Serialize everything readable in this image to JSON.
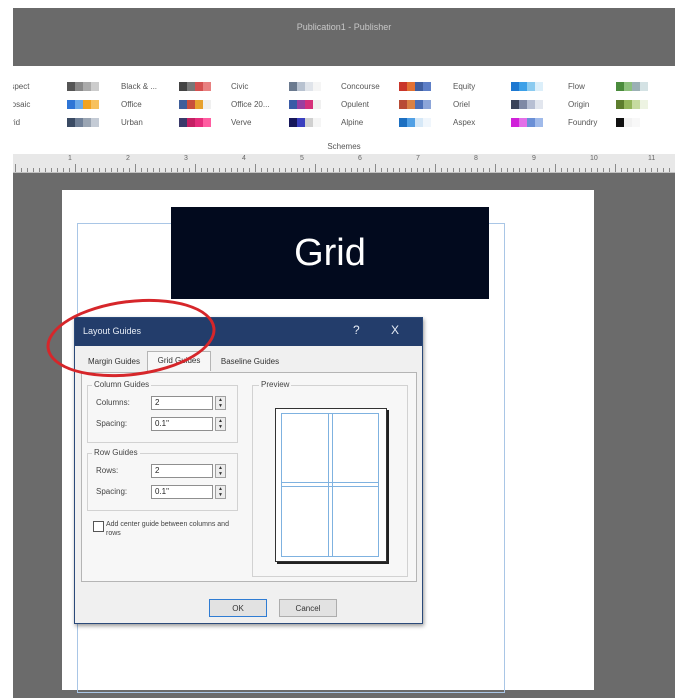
{
  "window": {
    "title": "Publication1 - Publisher"
  },
  "ribbon": {
    "group_label": "Schemes",
    "schemes": [
      {
        "name": "Aspect",
        "colors": [
          "#555555",
          "#888888",
          "#aaaaaa",
          "#cccccc"
        ]
      },
      {
        "name": "Mosaic",
        "colors": [
          "#2e75d6",
          "#6aa8e8",
          "#f2a321",
          "#f7c15d"
        ]
      },
      {
        "name": "Grid",
        "colors": [
          "#3a4a63",
          "#6f7f96",
          "#9aa5b3",
          "#c4cbd5"
        ]
      },
      {
        "name": "Black & ...",
        "colors": [
          "#444444",
          "#777777",
          "#d45050",
          "#e88080"
        ]
      },
      {
        "name": "Office",
        "colors": [
          "#3f5e9a",
          "#c94e3c",
          "#e7a12f",
          "#f0f0f0"
        ]
      },
      {
        "name": "Urban",
        "colors": [
          "#3a3a6a",
          "#c41f63",
          "#e52d7c",
          "#ff5da1"
        ]
      },
      {
        "name": "Civic",
        "colors": [
          "#6b7a8f",
          "#b8c2d0",
          "#e0e4ea",
          "#f5f5f5"
        ]
      },
      {
        "name": "Office 20...",
        "colors": [
          "#3a5ba6",
          "#9a3fa0",
          "#d6317b",
          "#f0f0f0"
        ]
      },
      {
        "name": "Verve",
        "colors": [
          "#16175a",
          "#3a3fbf",
          "#d0d0d0",
          "#f5f5f5"
        ]
      },
      {
        "name": "Concourse",
        "colors": [
          "#c9362b",
          "#e27133",
          "#3f5ea0",
          "#5d7ec6"
        ]
      },
      {
        "name": "Opulent",
        "colors": [
          "#b84b35",
          "#d98145",
          "#4b6fb8",
          "#8ca5d9"
        ]
      },
      {
        "name": "Alpine",
        "colors": [
          "#1c6fc1",
          "#51a0e5",
          "#d6e8f7",
          "#f0f6fc"
        ]
      },
      {
        "name": "Equity",
        "colors": [
          "#1d78d1",
          "#3ca0e8",
          "#8bcbf0",
          "#dceffa"
        ]
      },
      {
        "name": "Oriel",
        "colors": [
          "#3a4258",
          "#7f89a5",
          "#b7bfd3",
          "#e2e6ee"
        ]
      },
      {
        "name": "Aspex",
        "colors": [
          "#d021d9",
          "#e36fe8",
          "#6a8fd6",
          "#a0baea"
        ]
      },
      {
        "name": "Flow",
        "colors": [
          "#4a8b3c",
          "#8cc07c",
          "#9bb0b5",
          "#d4e2e4"
        ]
      },
      {
        "name": "Origin",
        "colors": [
          "#5d7d2d",
          "#93b55a",
          "#c6dba0",
          "#edf3e2"
        ]
      },
      {
        "name": "Foundry",
        "colors": [
          "#111111",
          "#f2f2f2",
          "#f8f8f8",
          "#ffffff"
        ]
      }
    ]
  },
  "ruler": {
    "labels": [
      "1",
      "2",
      "3",
      "4",
      "5",
      "6",
      "7",
      "8",
      "9",
      "10",
      "11"
    ]
  },
  "page": {
    "heading": "Grid"
  },
  "dialog": {
    "title": "Layout Guides",
    "help_glyph": "?",
    "close_glyph": "X",
    "tabs": [
      "Margin Guides",
      "Grid Guides",
      "Baseline Guides"
    ],
    "active_tab": "Grid Guides",
    "column_guides": {
      "label": "Column Guides",
      "columns_label": "Columns:",
      "columns_value": "2",
      "spacing_label": "Spacing:",
      "spacing_value": "0.1\""
    },
    "row_guides": {
      "label": "Row Guides",
      "rows_label": "Rows:",
      "rows_value": "2",
      "spacing_label": "Spacing:",
      "spacing_value": "0.1\""
    },
    "center_guide_label": "Add center guide between columns and rows",
    "center_guide_checked": false,
    "preview_label": "Preview",
    "ok_label": "OK",
    "cancel_label": "Cancel"
  },
  "annotation": {
    "color": "#d6262a"
  }
}
